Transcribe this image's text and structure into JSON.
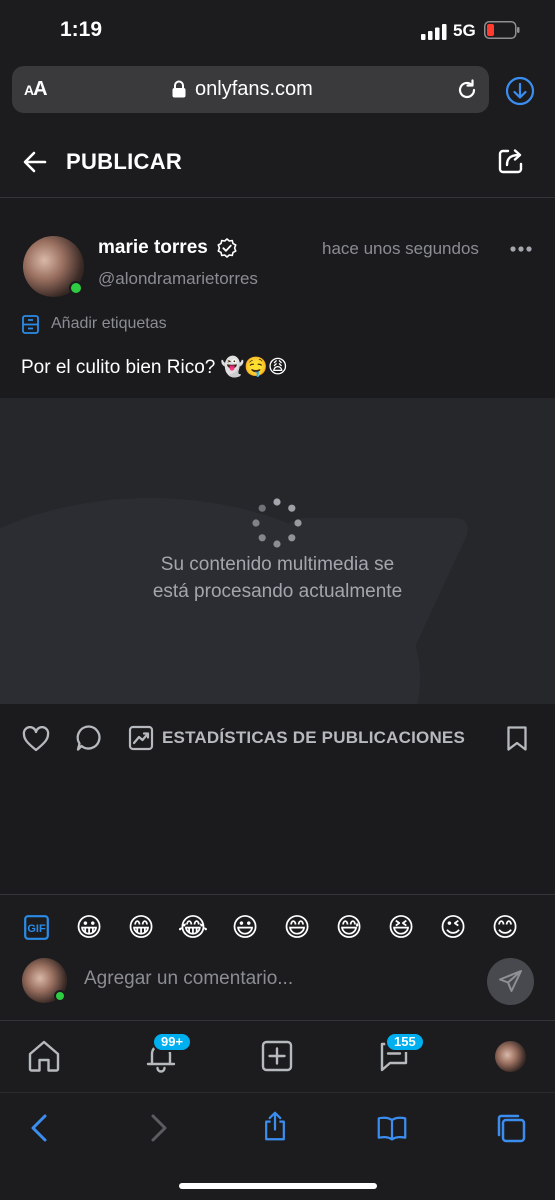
{
  "status_bar": {
    "time": "1:19",
    "network": "5G"
  },
  "browser": {
    "aa_label": "AA",
    "url": "onlyfans.com"
  },
  "header": {
    "title": "PUBLICAR"
  },
  "post": {
    "author_name": "marie torres",
    "handle": "@alondramarietorres",
    "timestamp": "hace unos segundos",
    "tags_label": "Añadir etiquetas",
    "caption": "Por el culito bien Rico? 👻🤤😩",
    "processing_line1": "Su contenido multimedia se",
    "processing_line2": "está procesando actualmente"
  },
  "actions": {
    "stats_label": "ESTADÍSTICAS DE PUBLICACIONES"
  },
  "composer": {
    "emojis": [
      "😀",
      "😁",
      "😂",
      "😃",
      "😄",
      "😅",
      "😆",
      "😉",
      "😊"
    ],
    "placeholder": "Agregar un comentario..."
  },
  "nav": {
    "notifications_badge": "99+",
    "messages_badge": "155"
  },
  "colors": {
    "accent": "#00aff0",
    "online": "#2ecc40",
    "safari_blue": "#3b8ef0"
  }
}
